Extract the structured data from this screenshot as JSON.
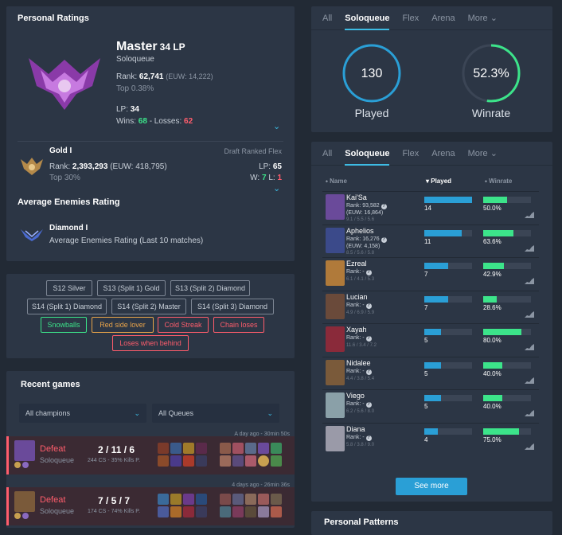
{
  "personal_ratings": {
    "title": "Personal Ratings",
    "solo": {
      "tier": "Master",
      "lp_label": "34 LP",
      "queue": "Soloqueue",
      "rank_label": "Rank:",
      "rank": "62,741",
      "rank_euw": "(EUW: 14,222)",
      "top": "Top 0.38%",
      "lp_prefix": "LP:",
      "lp": "34",
      "wins_prefix": "Wins:",
      "wins": "68",
      "losses_prefix": "- Losses:",
      "losses": "62"
    },
    "flex": {
      "tier": "Gold I",
      "queue": "Draft Ranked Flex",
      "rank_label": "Rank:",
      "rank": "2,393,293",
      "rank_euw": "(EUW: 418,795)",
      "top": "Top 30%",
      "lp_label": "LP:",
      "lp": "65",
      "w_label": "W:",
      "w": "7",
      "l_label": "L:",
      "l": "1"
    },
    "avg_title": "Average Enemies Rating",
    "avg": {
      "tier": "Diamond I",
      "desc": "Average Enemies Rating (Last 10 matches)"
    }
  },
  "badges": [
    {
      "label": "S12 Silver",
      "style": "grey"
    },
    {
      "label": "S13 (Split 1) Gold",
      "style": "grey"
    },
    {
      "label": "S13 (Split 2) Diamond",
      "style": "grey"
    },
    {
      "label": "S14 (Split 1) Diamond",
      "style": "grey"
    },
    {
      "label": "S14 (Split 2) Master",
      "style": "grey"
    },
    {
      "label": "S14 (Split 3) Diamond",
      "style": "grey"
    },
    {
      "label": "Snowballs",
      "style": "green"
    },
    {
      "label": "Red side lover",
      "style": "orange"
    },
    {
      "label": "Cold Streak",
      "style": "red"
    },
    {
      "label": "Chain loses",
      "style": "red"
    },
    {
      "label": "Loses when behind",
      "style": "red"
    }
  ],
  "recent": {
    "title": "Recent games",
    "champ_select": "All champions",
    "queue_select": "All Queues",
    "games": [
      {
        "result": "Defeat",
        "queue": "Soloqueue",
        "kda": "2 / 11 / 6",
        "cs": "244 CS - 35% Kills P.",
        "time": "A day ago - 30min 50s"
      },
      {
        "result": "Defeat",
        "queue": "Soloqueue",
        "kda": "7 / 5 / 7",
        "cs": "174 CS - 74% Kills P.",
        "time": "4 days ago - 26min 36s"
      }
    ]
  },
  "tabs": {
    "items": [
      "All",
      "Soloqueue",
      "Flex",
      "Arena",
      "More"
    ],
    "active": "Soloqueue",
    "chevron": "⌄"
  },
  "summary": {
    "played": "130",
    "played_label": "Played",
    "winrate": "52.3%",
    "winrate_label": "Winrate",
    "winrate_value": 52.3
  },
  "champions": {
    "head_name": "Name",
    "head_played": "Played",
    "head_winrate": "Winrate",
    "max_played": 14,
    "rows": [
      {
        "name": "Kai'Sa",
        "rank": "Rank: 93,582",
        "ext": "(EUW: 16,864)",
        "kda": "9.1 / 5.5 / 5.6",
        "played": 14,
        "winrate": "50.0%",
        "wr": 50.0,
        "color": "#6a4a9a"
      },
      {
        "name": "Aphelios",
        "rank": "Rank: 16,276",
        "ext": "(EUW: 4,158)",
        "kda": "8.5 / 5.6 / 5.8",
        "played": 11,
        "winrate": "63.6%",
        "wr": 63.6,
        "color": "#3b4a8a"
      },
      {
        "name": "Ezreal",
        "rank": "Rank: -",
        "ext": "",
        "kda": "6.1 / 4.1 / 5.3",
        "played": 7,
        "winrate": "42.9%",
        "wr": 42.9,
        "color": "#b07a3a"
      },
      {
        "name": "Lucian",
        "rank": "Rank: -",
        "ext": "",
        "kda": "4.9 / 6.9 / 5.9",
        "played": 7,
        "winrate": "28.6%",
        "wr": 28.6,
        "color": "#6a4a3a"
      },
      {
        "name": "Xayah",
        "rank": "Rank: -",
        "ext": "",
        "kda": "11.6 / 3.4 / 7.2",
        "played": 5,
        "winrate": "80.0%",
        "wr": 80.0,
        "color": "#8a2a3a"
      },
      {
        "name": "Nidalee",
        "rank": "Rank: -",
        "ext": "",
        "kda": "4.4 / 3.8 / 5.4",
        "played": 5,
        "winrate": "40.0%",
        "wr": 40.0,
        "color": "#7a5a3a"
      },
      {
        "name": "Viego",
        "rank": "Rank: -",
        "ext": "",
        "kda": "6.2 / 5.6 / 8.0",
        "played": 5,
        "winrate": "40.0%",
        "wr": 40.0,
        "color": "#8aa0a8"
      },
      {
        "name": "Diana",
        "rank": "Rank: -",
        "ext": "",
        "kda": "5.8 / 3.8 / 9.0",
        "played": 4,
        "winrate": "75.0%",
        "wr": 75.0,
        "color": "#9a9aa8"
      }
    ],
    "see_more": "See more"
  },
  "patterns": {
    "title": "Personal Patterns"
  }
}
